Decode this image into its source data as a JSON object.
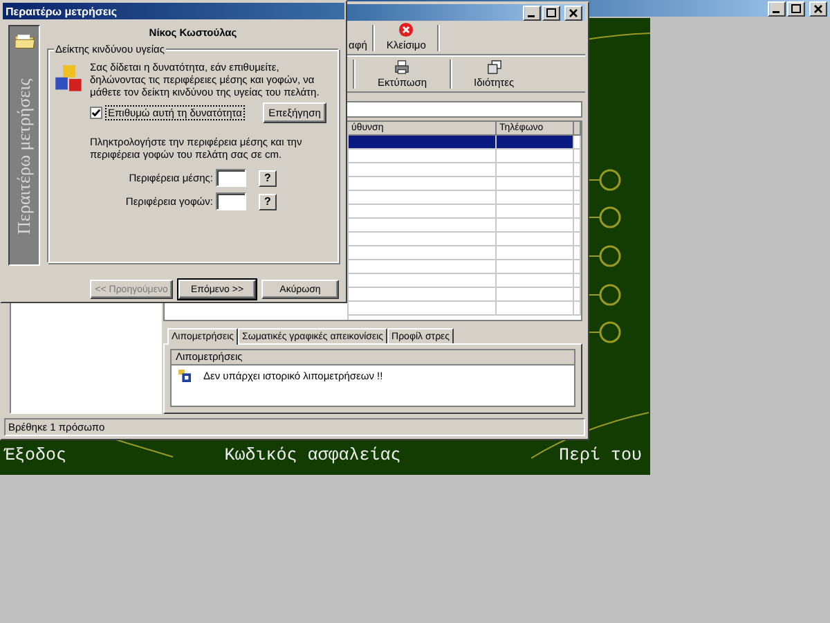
{
  "main_window": {
    "menu_items": [
      {
        "label": "Έξοδος"
      },
      {
        "label": "Κωδικός ασφαλείας"
      },
      {
        "label": "Περί του"
      }
    ]
  },
  "records_window": {
    "toolbar_rows": [
      [
        {
          "label": "αφή",
          "kind": "cut"
        },
        {
          "label": "Κλείσιμο",
          "kind": "close"
        }
      ],
      [
        {
          "label": "Εκτύπωση",
          "kind": "print"
        },
        {
          "label": "Ιδιότητες",
          "kind": "properties"
        }
      ]
    ],
    "table": {
      "columns": [
        "ύθυνση",
        "Τηλέφωνο"
      ],
      "rows": [
        {
          "selected": true
        },
        {
          "selected": false
        },
        {
          "selected": false
        },
        {
          "selected": false
        },
        {
          "selected": false
        },
        {
          "selected": false
        },
        {
          "selected": false
        },
        {
          "selected": false
        },
        {
          "selected": false
        },
        {
          "selected": false
        },
        {
          "selected": false
        },
        {
          "selected": false
        },
        {
          "selected": false
        }
      ]
    },
    "tabs": [
      {
        "label": "Λιπομετρήσεις",
        "selected": true
      },
      {
        "label": "Σωματικές γραφικές απεικονίσεις",
        "selected": false
      },
      {
        "label": "Προφίλ στρες",
        "selected": false
      }
    ],
    "history_panel": {
      "title": "Λιπομετρήσεις",
      "items": [
        "Δεν υπάρχει ιστορικό λιπομετρήσεων !!"
      ]
    },
    "status_bar": "Βρέθηκε 1 πρόσωπο"
  },
  "dialog": {
    "title": "Περαιτέρω μετρήσεις",
    "sidebar_caption": "Περαιτέρω μετρήσεις",
    "person_name": "Νίκος Κωστούλας",
    "group": {
      "title": "Δείκτης κινδύνου υγείας",
      "description": "Σας δίδεται η δυνατότητα, εάν επιθυμείτε, δηλώνοντας τις περιφέρειες μέσης και γοφών, να μάθετε τον δείκτη κινδύνου της υγείας του πελάτη.",
      "checkbox": {
        "label": "Επιθυμώ αυτή τη δυνατότητα",
        "checked": true
      },
      "explain_button": "Επεξήγηση",
      "instruction": "Πληκτρολογήστε την περιφέρεια μέσης και την περιφέρεια γοφών του πελάτη σας σε cm.",
      "fields": [
        {
          "label": "Περιφέρεια μέσης:",
          "help": "?"
        },
        {
          "label": "Περιφέρεια γοφών:",
          "help": "?"
        }
      ]
    },
    "buttons": [
      {
        "label": "<< Προηγούμενο",
        "disabled": true,
        "default": false
      },
      {
        "label": "Επόμενο >>",
        "disabled": false,
        "default": true
      },
      {
        "label": "Ακύρωση",
        "disabled": false,
        "default": false
      }
    ]
  }
}
